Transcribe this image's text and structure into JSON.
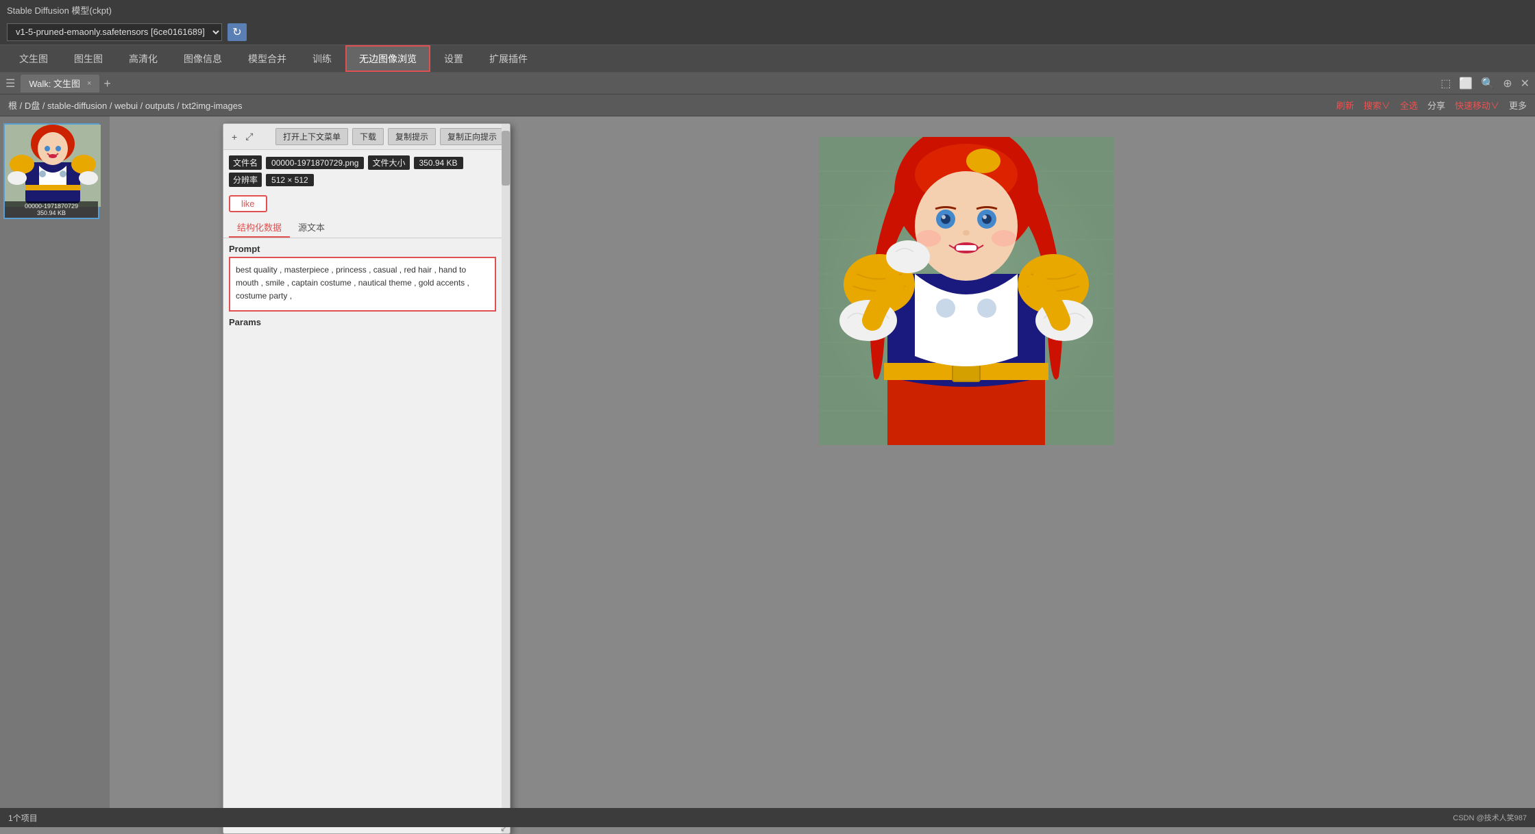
{
  "app": {
    "title": "Stable Diffusion 模型(ckpt)"
  },
  "model_row": {
    "model_select_value": "v1-5-pruned-emaonly.safetensors [6ce0161689]",
    "refresh_icon": "↻"
  },
  "nav_tabs": [
    {
      "id": "txt2img",
      "label": "文生图",
      "active": false
    },
    {
      "id": "img2img",
      "label": "图生图",
      "active": false
    },
    {
      "id": "highres",
      "label": "高清化",
      "active": false
    },
    {
      "id": "imginfo",
      "label": "图像信息",
      "active": false
    },
    {
      "id": "merge",
      "label": "模型合并",
      "active": false
    },
    {
      "id": "train",
      "label": "训练",
      "active": false
    },
    {
      "id": "infinite",
      "label": "无边图像浏览",
      "active": true
    },
    {
      "id": "settings",
      "label": "设置",
      "active": false
    },
    {
      "id": "extensions",
      "label": "扩展插件",
      "active": false
    }
  ],
  "tab_strip": {
    "icon_list": "☰",
    "tab_label": "Walk: 文生图",
    "tab_close": "×",
    "tab_add": "+",
    "icons_right": [
      "⬚",
      "⬜",
      "🔍",
      "⊕",
      "✕"
    ]
  },
  "breadcrumb": {
    "path": "根 / D盘 / stable-diffusion / webui / outputs / txt2img-images",
    "actions": [
      "刷新",
      "搜索∨",
      "全选",
      "分享",
      "快速移动∨",
      "更多"
    ]
  },
  "file_thumbnail": {
    "filename": "00000-1971870729",
    "filesize": "350.94 KB",
    "selected": true
  },
  "popup": {
    "toolbar": {
      "expand_icon1": "+",
      "expand_icon2": "⤢",
      "btn_open": "打开上下文菜单",
      "btn_download": "下载",
      "btn_copy_prompt": "复制提示",
      "btn_copy_positive": "复制正向提示"
    },
    "meta": {
      "filename_label": "文件名",
      "filename_value": "00000-1971870729.png",
      "filesize_label": "文件大小",
      "filesize_value": "350.94 KB",
      "resolution_label": "分辨率",
      "resolution_value": "512 × 512"
    },
    "like_label": "like",
    "tabs": [
      {
        "id": "structured",
        "label": "结构化数据",
        "active": true
      },
      {
        "id": "source",
        "label": "源文本",
        "active": false
      }
    ],
    "prompt_section": {
      "label": "Prompt",
      "text": "best quality , masterpiece , princess , casual , red hair , hand to mouth , smile , captain costume , nautical theme , gold accents , costume party ,"
    },
    "params_label": "Params"
  },
  "preview_image": {
    "alt": "Girl in red hair captain costume"
  },
  "status_bar": {
    "count": "1个项目",
    "right_text": "CSDN @技术人笑987"
  }
}
